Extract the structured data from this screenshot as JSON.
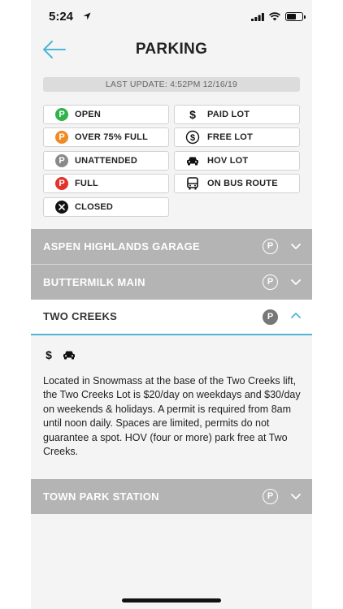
{
  "status_bar": {
    "time": "5:24"
  },
  "header": {
    "title": "PARKING"
  },
  "last_update": "LAST UPDATE: 4:52PM 12/16/19",
  "legend": {
    "open": "OPEN",
    "over75": "OVER 75% FULL",
    "unattended": "UNATTENDED",
    "full": "FULL",
    "closed": "CLOSED",
    "paid": "PAID LOT",
    "free": "FREE LOT",
    "hov": "HOV LOT",
    "bus": "ON BUS ROUTE",
    "badge_letter": "P"
  },
  "colors": {
    "open": "#2fb34a",
    "over75": "#f08a24",
    "unattended": "#8a8a8a",
    "full": "#e4322b",
    "closed": "#111111",
    "accent": "#4fb6d8"
  },
  "lots": [
    {
      "name": "ASPEN HIGHLANDS GARAGE",
      "status": "P",
      "expanded": false
    },
    {
      "name": "BUTTERMILK MAIN",
      "status": "P",
      "expanded": false
    },
    {
      "name": "TWO CREEKS",
      "status": "P",
      "expanded": true,
      "icons": [
        "dollar-icon",
        "car-icon"
      ],
      "description": "Located in Snowmass at the base of the Two Creeks lift, the Two Creeks Lot is $20/day on weekdays and $30/day on weekends & holidays. A permit is required from 8am until noon daily. Spaces are limited, permits do not guarantee a spot. HOV (four or more) park free at Two Creeks."
    },
    {
      "name": "TOWN PARK STATION",
      "status": "P",
      "expanded": false
    }
  ]
}
